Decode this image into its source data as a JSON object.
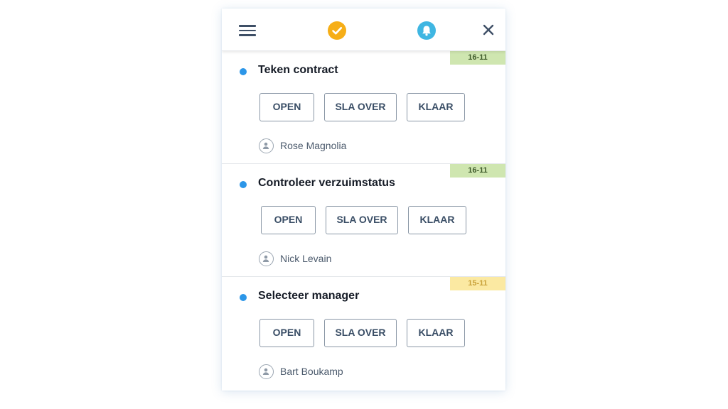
{
  "header": {
    "menu_icon": "hamburger-menu-icon",
    "check_icon": "check-circle-icon",
    "bell_icon": "bell-icon",
    "close_icon": "close-icon",
    "check_color": "#f6ae17",
    "bell_color": "#3fb6e2"
  },
  "tasks": [
    {
      "title": "Teken contract",
      "date": "16-11",
      "date_status": "green",
      "actions": {
        "open": "OPEN",
        "skip": "SLA OVER",
        "done": "KLAAR"
      },
      "assignee": "Rose Magnolia"
    },
    {
      "title": "Controleer verzuimstatus",
      "date": "16-11",
      "date_status": "green",
      "actions": {
        "open": "OPEN",
        "skip": "SLA OVER",
        "done": "KLAAR"
      },
      "assignee": "Nick Levain"
    },
    {
      "title": "Selecteer manager",
      "date": "15-11",
      "date_status": "yellow",
      "actions": {
        "open": "OPEN",
        "skip": "SLA OVER",
        "done": "KLAAR"
      },
      "assignee": "Bart Boukamp"
    }
  ],
  "colors": {
    "accent_dot": "#2c96e8",
    "badge_green": "#cfe6b0",
    "badge_yellow": "#fbe9a2",
    "button_border": "#8a97a6",
    "button_text": "#3a4e66"
  }
}
